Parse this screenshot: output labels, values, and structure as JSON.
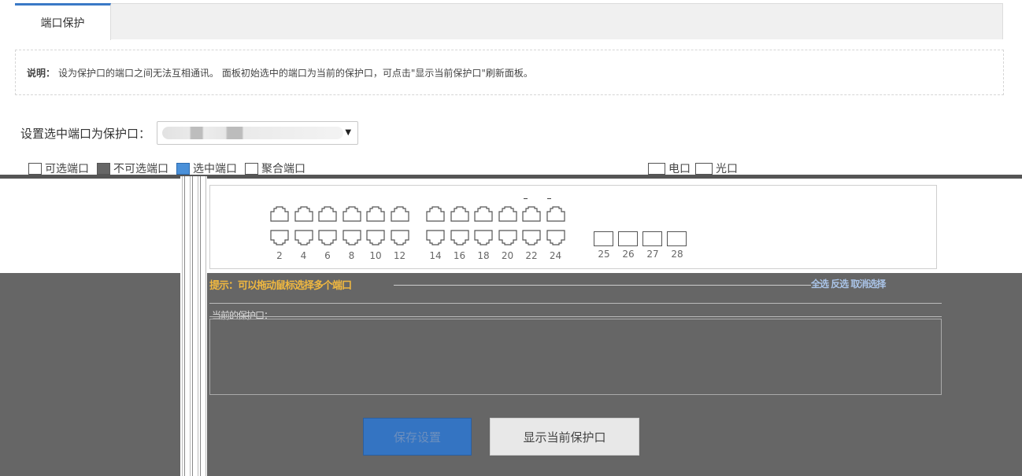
{
  "tabs": [
    {
      "label": "端口保护"
    }
  ],
  "description": {
    "label": "说明：",
    "text": "设为保护口的端口之间无法互相通讯。 面板初始选中的端口为当前的保护口，可点击\"显示当前保护口\"刷新面板。"
  },
  "select_row": {
    "label": "设置选中端口为保护口：",
    "selected_value": ""
  },
  "legend": {
    "items": [
      "可选端口",
      "不可选端口",
      "选中端口",
      "聚合端口"
    ],
    "right_items": [
      "电口",
      "光口"
    ]
  },
  "panel": {
    "copper_labels": [
      "2",
      "4",
      "6",
      "8",
      "10",
      "12",
      "14",
      "16",
      "18",
      "20",
      "22",
      "24"
    ],
    "fiber_labels": [
      "25",
      "26",
      "27",
      "28"
    ]
  },
  "dialog": {
    "title": "提示：可以拖动鼠标选择多个端口",
    "links": "全选  反选  取消选择",
    "current_label": "当前的保护口："
  },
  "buttons": {
    "save": "保存设置",
    "show_current": "显示当前保护口"
  },
  "colors": {
    "accent": "#3a79c6",
    "primary_button": "#3474c2",
    "overlay": "#666666"
  }
}
